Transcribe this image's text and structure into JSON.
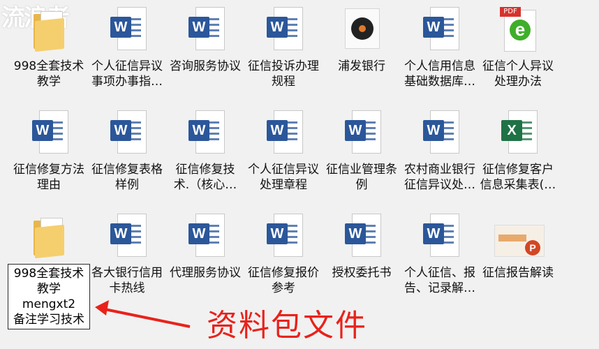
{
  "watermark": "流浪者",
  "rows": [
    [
      {
        "label": "998全套技术\n教学",
        "type": "folder"
      },
      {
        "label": "个人征信异议\n事项办事指…",
        "type": "word"
      },
      {
        "label": "咨询服务协议",
        "type": "word"
      },
      {
        "label": "征信投诉办理\n规程",
        "type": "word"
      },
      {
        "label": "浦发银行",
        "type": "disc"
      },
      {
        "label": "个人信用信息\n基础数据库…",
        "type": "word"
      },
      {
        "label": "征信个人异议\n处理办法",
        "type": "pdf"
      }
    ],
    [
      {
        "label": "征信修复方法\n理由",
        "type": "word"
      },
      {
        "label": "征信修复表格\n样例",
        "type": "word"
      },
      {
        "label": "征信修复技\n术.（核心…",
        "type": "word"
      },
      {
        "label": "个人征信异议\n处理章程",
        "type": "word"
      },
      {
        "label": "征信业管理条\n例",
        "type": "word"
      },
      {
        "label": "农村商业银行\n征信异议处…",
        "type": "word"
      },
      {
        "label": "征信修复客户\n信息采集表(…",
        "type": "excel"
      }
    ],
    [
      {
        "label": "998全套技术\n教学\nmengxt2\n备注学习技术",
        "type": "folder",
        "selected": true
      },
      {
        "label": "各大银行信用\n卡热线",
        "type": "word"
      },
      {
        "label": "代理服务协议",
        "type": "word"
      },
      {
        "label": "征信修复报价\n参考",
        "type": "word"
      },
      {
        "label": "授权委托书",
        "type": "word"
      },
      {
        "label": "个人征信、报\n告、记录解…",
        "type": "word"
      },
      {
        "label": "征信报告解读",
        "type": "ppt"
      }
    ]
  ],
  "badges": {
    "word": "W",
    "excel": "X",
    "pdf": "PDF",
    "pdf_letter": "e",
    "ppt": "P"
  },
  "annotation": {
    "text": "资料包文件",
    "color": "#e8221b"
  }
}
